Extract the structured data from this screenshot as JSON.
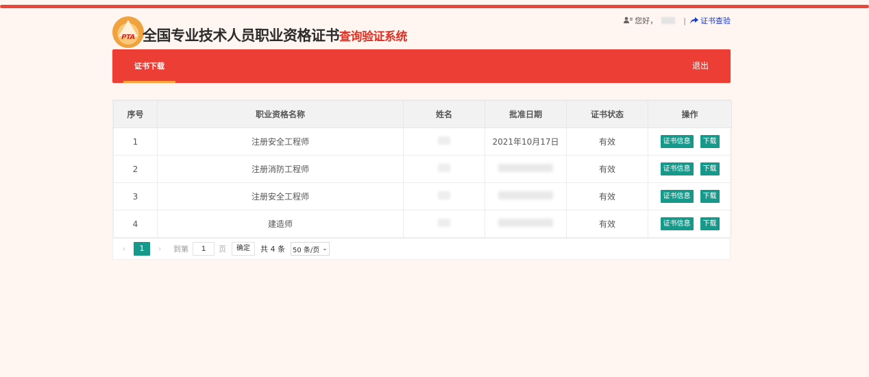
{
  "header": {
    "logo_text": "PTA",
    "title_main": "全国专业技术人员职业资格证书",
    "title_sub": "查询验证系统",
    "greeting": "您好，",
    "separator": "|",
    "verify_link": "证书查验"
  },
  "nav": {
    "tab_label": "证书下载",
    "logout_label": "退出"
  },
  "table": {
    "headers": [
      "序号",
      "职业资格名称",
      "姓名",
      "批准日期",
      "证书状态",
      "操作"
    ],
    "rows": [
      {
        "index": "1",
        "qualification": "注册安全工程师",
        "date": "2021年10月17日",
        "status": "有效"
      },
      {
        "index": "2",
        "qualification": "注册消防工程师",
        "date": "",
        "status": "有效"
      },
      {
        "index": "3",
        "qualification": "注册安全工程师",
        "date": "",
        "status": "有效"
      },
      {
        "index": "4",
        "qualification": "建造师",
        "date": "",
        "status": "有效"
      }
    ],
    "btn_info": "证书信息",
    "btn_download": "下载"
  },
  "pager": {
    "current_page": "1",
    "goto_label": "到第",
    "page_input": "1",
    "page_unit": "页",
    "confirm_label": "确定",
    "total_text": "共 4 条",
    "page_size": "50 条/页"
  },
  "icons": {
    "user": "user-icon",
    "verify": "share-arrow-icon",
    "prev": "chevron-left-icon",
    "next": "chevron-right-icon",
    "select": "chevron-down-icon"
  },
  "colors": {
    "nav_bg": "#ec3e34",
    "accent_btn": "#16988a",
    "tab_indicator": "#f7a33a",
    "link": "#1a3bc4"
  }
}
